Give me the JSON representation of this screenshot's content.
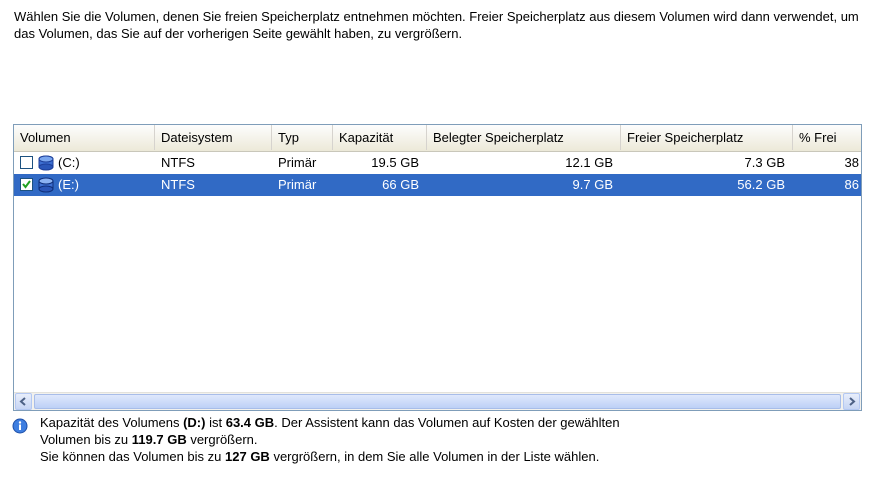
{
  "intro_text": "Wählen Sie die Volumen, denen Sie freien Speicherplatz entnehmen möchten. Freier Speicherplatz aus diesem Volumen wird dann verwendet, um das Volumen, das Sie auf der vorherigen Seite gewählt haben, zu vergrößern.",
  "table": {
    "columns": [
      "Volumen",
      "Dateisystem",
      "Typ",
      "Kapazität",
      "Belegter Speicherplatz",
      "Freier Speicherplatz",
      "% Frei"
    ],
    "rows": [
      {
        "checked": false,
        "selected": false,
        "volume": "(C:)",
        "filesystem": "NTFS",
        "type": "Primär",
        "capacity": "19.5 GB",
        "used": "12.1 GB",
        "free": "7.3 GB",
        "percent_free": "38"
      },
      {
        "checked": true,
        "selected": true,
        "volume": "(E:)",
        "filesystem": "NTFS",
        "type": "Primär",
        "capacity": "66 GB",
        "used": "9.7 GB",
        "free": "56.2 GB",
        "percent_free": "86"
      }
    ]
  },
  "info": {
    "line1_a": "Kapazität des Volumens ",
    "line1_vol": "(D:)",
    "line1_b": " ist ",
    "line1_cap": "63.4 GB",
    "line1_c": ". Der Assistent kann das Volumen auf Kosten der gewählten",
    "line2_a": "Volumen bis zu ",
    "line2_max": "119.7 GB",
    "line2_b": " vergrößern.",
    "line3_a": "Sie können das Volumen bis zu ",
    "line3_max": "127 GB",
    "line3_b": " vergrößern, in dem Sie alle Volumen in der Liste wählen."
  },
  "colors": {
    "selection": "#316ac5",
    "border": "#7f9db9"
  }
}
